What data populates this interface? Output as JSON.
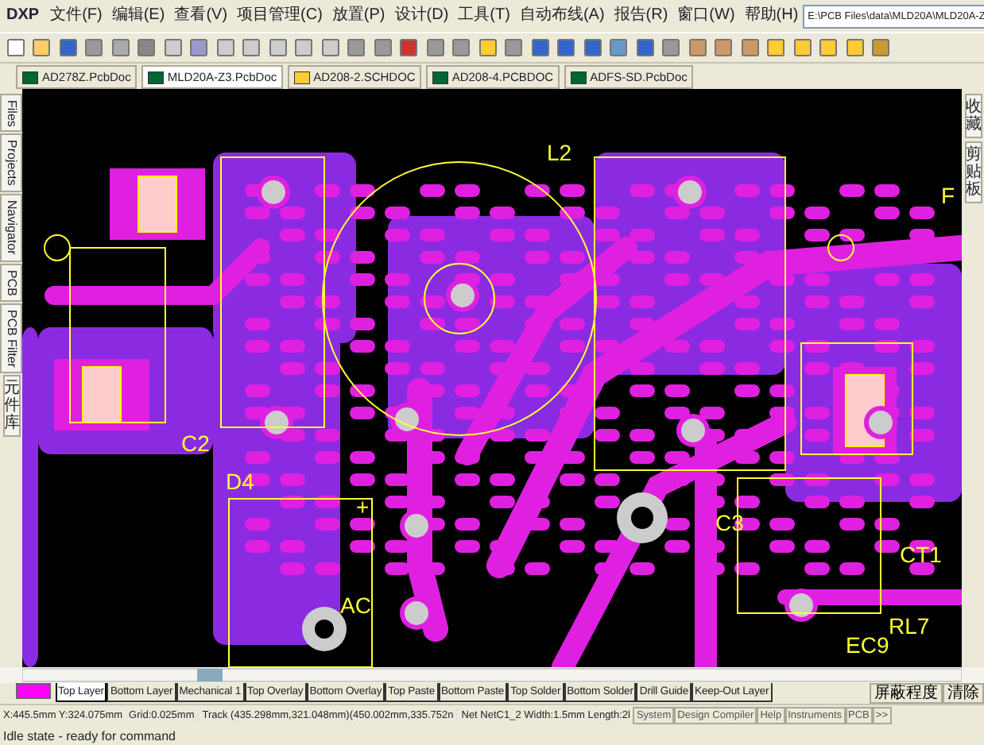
{
  "menu_bar": {
    "logo": "DXP",
    "items": [
      "文件(F)",
      "编辑(E)",
      "查看(V)",
      "项目管理(C)",
      "放置(P)",
      "设计(D)",
      "工具(T)",
      "自动布线(A)",
      "报告(R)",
      "窗口(W)",
      "帮助(H)"
    ],
    "path": "E:\\PCB Files\\data\\MLD20A\\MLD20A-Z"
  },
  "document_tabs": [
    {
      "label": "AD278Z.PcbDoc",
      "kind": "pcb",
      "selected": false
    },
    {
      "label": "MLD20A-Z3.PcbDoc",
      "kind": "pcb",
      "selected": true
    },
    {
      "label": "AD208-2.SCHDOC",
      "kind": "sch",
      "selected": false
    },
    {
      "label": "AD208-4.PCBDOC",
      "kind": "pcb",
      "selected": false
    },
    {
      "label": "ADFS-SD.PcbDoc",
      "kind": "pcb",
      "selected": false
    }
  ],
  "left_panel_tabs": [
    {
      "label": "Files",
      "kind": "latin"
    },
    {
      "label": "Projects",
      "kind": "latin"
    },
    {
      "label": "Navigator",
      "kind": "latin"
    },
    {
      "label": "PCB",
      "kind": "latin"
    },
    {
      "label": "PCB Filter",
      "kind": "latin"
    },
    {
      "label": "元件库",
      "kind": "cjk"
    }
  ],
  "right_panel_tabs": [
    {
      "label": "收藏",
      "kind": "cjk"
    },
    {
      "label": "剪贴板",
      "kind": "cjk"
    }
  ],
  "canvas": {
    "designators": [
      "L2",
      "C2",
      "C3",
      "CT1",
      "AC",
      "+",
      "D4",
      "EC9",
      "RL7",
      "F"
    ]
  },
  "layer_bar": {
    "layers": [
      {
        "label": "Top Layer",
        "selected": true
      },
      {
        "label": "Bottom Layer",
        "selected": false
      },
      {
        "label": "Mechanical 1",
        "selected": false
      },
      {
        "label": "Top Overlay",
        "selected": false
      },
      {
        "label": "Bottom Overlay",
        "selected": false
      },
      {
        "label": "Top Paste",
        "selected": false
      },
      {
        "label": "Bottom Paste",
        "selected": false
      },
      {
        "label": "Top Solder",
        "selected": false
      },
      {
        "label": "Bottom Solder",
        "selected": false
      },
      {
        "label": "Drill Guide",
        "selected": false
      },
      {
        "label": "Keep-Out Layer",
        "selected": false
      }
    ],
    "buttons": [
      "屏蔽程度",
      "清除"
    ]
  },
  "status_bar": {
    "coordinates": "X:445.5mm Y:324.075mm",
    "grid": "Grid:0.025mm",
    "track": "Track (435.298mm,321.048mm)(450.002mm,335.752n",
    "net": "Net NetC1_2 Width:1.5mm Length:2l",
    "panel_buttons": [
      "System",
      "Design Compiler",
      "Help",
      "Instruments",
      "PCB",
      ">>"
    ],
    "message": "Idle state - ready for command"
  }
}
